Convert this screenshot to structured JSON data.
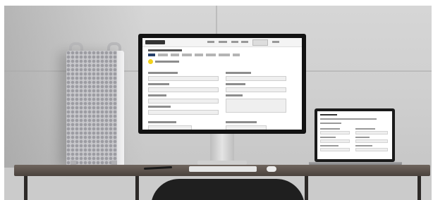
{
  "scene": {
    "objects": [
      {
        "name": "mac-pro-tower",
        "kind": "computer tower"
      },
      {
        "name": "desktop-monitor",
        "kind": "monitor showing a form web page"
      },
      {
        "name": "laptop",
        "kind": "laptop showing a form web page"
      },
      {
        "name": "keyboard",
        "kind": "keyboard"
      },
      {
        "name": "mouse",
        "kind": "mouse"
      },
      {
        "name": "desk",
        "kind": "dark wood desk"
      },
      {
        "name": "chair",
        "kind": "black office chair"
      }
    ],
    "colors": {
      "wall": "#d2d2d2",
      "desk": "#5a514b",
      "tower": "#c9c9cc",
      "accent_yellow": "#f2d21b",
      "accent_navy": "#27406a"
    }
  }
}
